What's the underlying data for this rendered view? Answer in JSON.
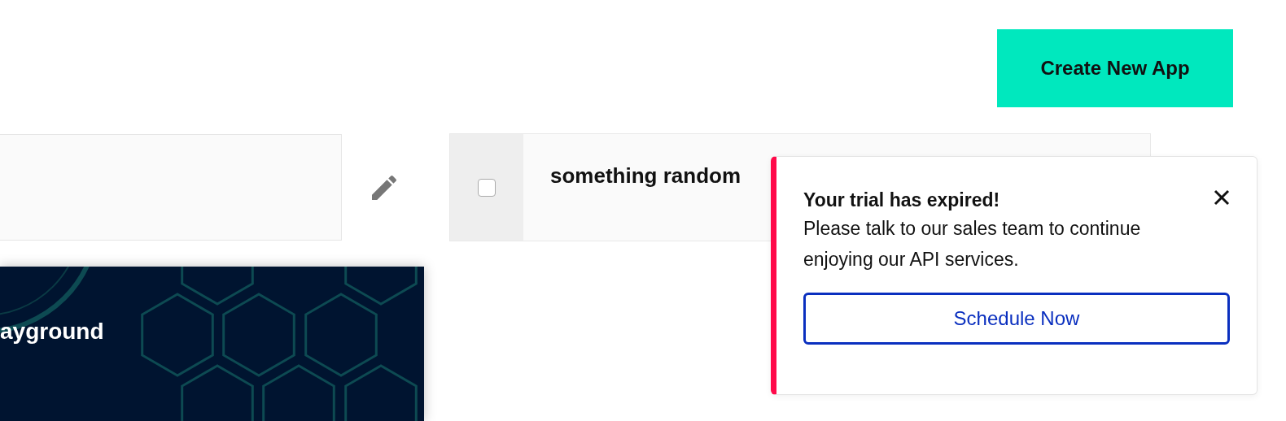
{
  "header": {
    "create_button": "Create New App"
  },
  "app_card": {
    "checked": false,
    "title": "something random"
  },
  "playground_card": {
    "kind": "picture",
    "title": "ayground"
  },
  "toast": {
    "title": "Your trial has expired!",
    "message": "Please talk to our sales team to continue enjoying our API services.",
    "action": "Schedule Now"
  }
}
